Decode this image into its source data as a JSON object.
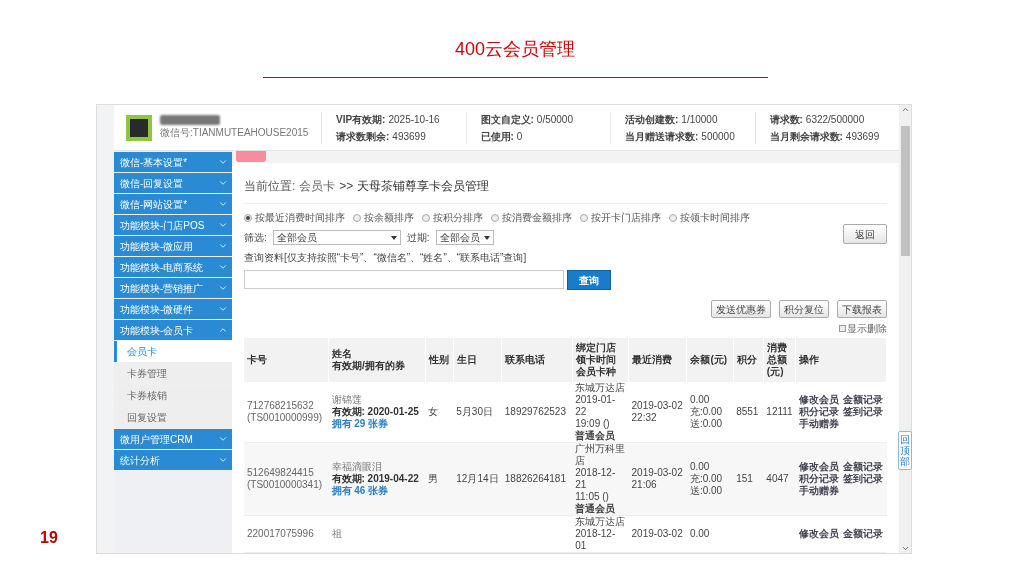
{
  "slide": {
    "title": "400云会员管理",
    "page_number": "19"
  },
  "header": {
    "account_id": "微信号:TIANMUTEAHOUSE2015",
    "stats": [
      {
        "label": "VIP有效期:",
        "value": "2025-10-16"
      },
      {
        "label": "请求数剩余:",
        "value": "493699"
      },
      {
        "label": "图文自定义:",
        "value": "0/50000"
      },
      {
        "label": "已使用:",
        "value": "0"
      },
      {
        "label": "活动创建数:",
        "value": "1/10000"
      },
      {
        "label": "当月赠送请求数:",
        "value": "500000"
      },
      {
        "label": "请求数:",
        "value": "6322/500000"
      },
      {
        "label": "当月剩余请求数:",
        "value": "493699"
      }
    ]
  },
  "sidebar": {
    "items": [
      {
        "label": "微信-基本设置*",
        "expanded": false
      },
      {
        "label": "微信-回复设置",
        "expanded": false
      },
      {
        "label": "微信-网站设置*",
        "expanded": false
      },
      {
        "label": "功能模块-门店POS",
        "expanded": false
      },
      {
        "label": "功能模块-微应用",
        "expanded": false
      },
      {
        "label": "功能模块-电商系统",
        "expanded": false
      },
      {
        "label": "功能模块-营销推广",
        "expanded": false
      },
      {
        "label": "功能模块-微硬件",
        "expanded": false
      },
      {
        "label": "功能模块-会员卡",
        "expanded": true,
        "children": [
          {
            "label": "会员卡",
            "selected": true
          },
          {
            "label": "卡券管理",
            "selected": false
          },
          {
            "label": "卡券核销",
            "selected": false
          },
          {
            "label": "回复设置",
            "selected": false
          }
        ]
      },
      {
        "label": "微用户管理CRM",
        "expanded": false
      },
      {
        "label": "统计分析",
        "expanded": false
      }
    ]
  },
  "breadcrumb": {
    "label": "当前位置:",
    "link": "会员卡",
    "separator": ">>",
    "current": "天母茶铺尊享卡会员管理"
  },
  "sort_options": [
    {
      "label": "按最近消费时间排序",
      "selected": true
    },
    {
      "label": "按余额排序",
      "selected": false
    },
    {
      "label": "按积分排序",
      "selected": false
    },
    {
      "label": "按消费金额排序",
      "selected": false
    },
    {
      "label": "按开卡门店排序",
      "selected": false
    },
    {
      "label": "按领卡时间排序",
      "selected": false
    }
  ],
  "filters": [
    {
      "label": "筛选:",
      "value": "全部会员"
    },
    {
      "label": "过期:",
      "value": "全部会员"
    }
  ],
  "search": {
    "label": "查询资料[仅支持按照“卡号”、“微信名”、“姓名”、“联系电话”查询]",
    "button": "查询"
  },
  "back_button": "返回",
  "actions": [
    "发送优惠券",
    "积分复位",
    "下载报表"
  ],
  "show_deleted": {
    "label": "显示删除",
    "checked": false
  },
  "table": {
    "columns": [
      [
        "卡号"
      ],
      [
        "姓名",
        "有效期/拥有的券"
      ],
      [
        "性别"
      ],
      [
        "生日"
      ],
      [
        "联系电话"
      ],
      [
        "绑定门店",
        "领卡时间",
        "会员卡种"
      ],
      [
        "最近消费"
      ],
      [
        "余额(元)"
      ],
      [
        "积分"
      ],
      [
        "消费",
        "总额",
        "(元)"
      ],
      [
        "操作"
      ]
    ],
    "rows": [
      {
        "card": [
          "712768215632",
          "(TS0010000999)"
        ],
        "name": "谢锦莲",
        "validity": "有效期: 2020-01-25",
        "coupons": "拥有 29 张券",
        "gender": "女",
        "birthday": "5月30日",
        "phone": "18929762523",
        "store": [
          "东城万达店",
          "2019-01-22",
          "19:09 ()"
        ],
        "card_type": "普通会员",
        "recent": [
          "2019-03-02",
          "22:32"
        ],
        "balance": [
          "0.00",
          "充:0.00",
          "送:0.00"
        ],
        "points": "8551",
        "total": "12111",
        "ops": [
          "修改会员",
          "金额记录",
          "积分记录",
          "签到记录",
          "手动赠券"
        ]
      },
      {
        "card": [
          "512649824415",
          "(TS0010000341)"
        ],
        "name": "幸福滴眼泪",
        "validity": "有效期: 2019-04-22",
        "coupons": "拥有 46 张券",
        "gender": "男",
        "birthday": "12月14日",
        "phone": "18826264181",
        "store": [
          "广州万科里",
          "店",
          "2018-12-21",
          "11:05 ()"
        ],
        "card_type": "普通会员",
        "recent": [
          "2019-03-02",
          "21:06"
        ],
        "balance": [
          "0.00",
          "充:0.00",
          "送:0.00"
        ],
        "points": "151",
        "total": "4047",
        "ops": [
          "修改会员",
          "金额记录",
          "积分记录",
          "签到记录",
          "手动赠券"
        ]
      },
      {
        "card": [
          "220017075996"
        ],
        "name": "祖",
        "store": [
          "东城万达店",
          "2018-12-01"
        ],
        "recent": [
          "2019-03-02"
        ],
        "balance": [
          "0.00"
        ],
        "ops": [
          "修改会员",
          "金额记录"
        ]
      }
    ]
  },
  "back_to_top": "回顶部"
}
